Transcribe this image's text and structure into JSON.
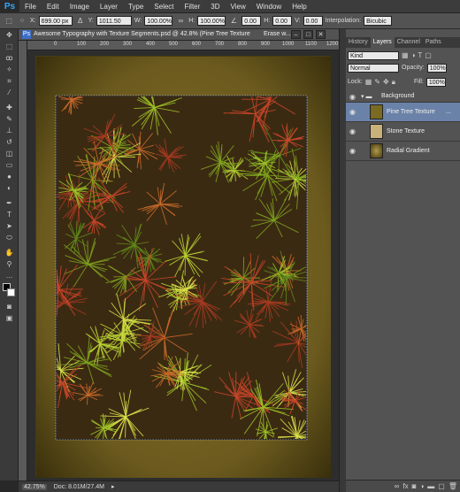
{
  "app": {
    "logo": "Ps"
  },
  "menu": [
    "File",
    "Edit",
    "Image",
    "Layer",
    "Type",
    "Select",
    "Filter",
    "3D",
    "View",
    "Window",
    "Help"
  ],
  "options": {
    "x_label": "X:",
    "x_value": "699.00 px",
    "y_label": "Y:",
    "y_value": "1011.50 px",
    "w_label": "W:",
    "w_value": "100.00%",
    "h_label": "H:",
    "h_value": "100.00%",
    "angle_value": "0.00",
    "hskew_label": "H:",
    "hskew_value": "0.00",
    "vskew_label": "V:",
    "vskew_value": "0.00",
    "interp_label": "Interpolation:",
    "interp_value": "Bicubic"
  },
  "document": {
    "title": "Awesome Typography with Texture Segments.psd @ 42.8% (Pine Tree Texture",
    "title_extra": "Erase w..."
  },
  "ruler_top": [
    "0",
    "100",
    "200",
    "300",
    "400",
    "500",
    "600",
    "700",
    "800",
    "900",
    "1000",
    "1100",
    "1200",
    "1300",
    "1400"
  ],
  "status": {
    "zoom": "42.75%",
    "doc": "Doc: 8.01M/27.4M"
  },
  "panel": {
    "tabs": [
      "History",
      "Layers",
      "Channel",
      "Paths"
    ],
    "active_tab": "Layers",
    "kind": "Kind",
    "blend": "Normal",
    "opacity_label": "Opacity:",
    "opacity_value": "100%",
    "lock_label": "Lock:",
    "fill_label": "Fill:",
    "fill_value": "100%",
    "group_name": "Background",
    "layers": [
      {
        "name": "Pine Tree Texture",
        "extra": "...",
        "selected": true
      },
      {
        "name": "Stone Texture"
      },
      {
        "name": "Radial Gradient"
      }
    ]
  },
  "colors": {
    "accent": "#31a8ff",
    "selection": "#6b82a8",
    "texture_bg": "#6b5a1e"
  }
}
